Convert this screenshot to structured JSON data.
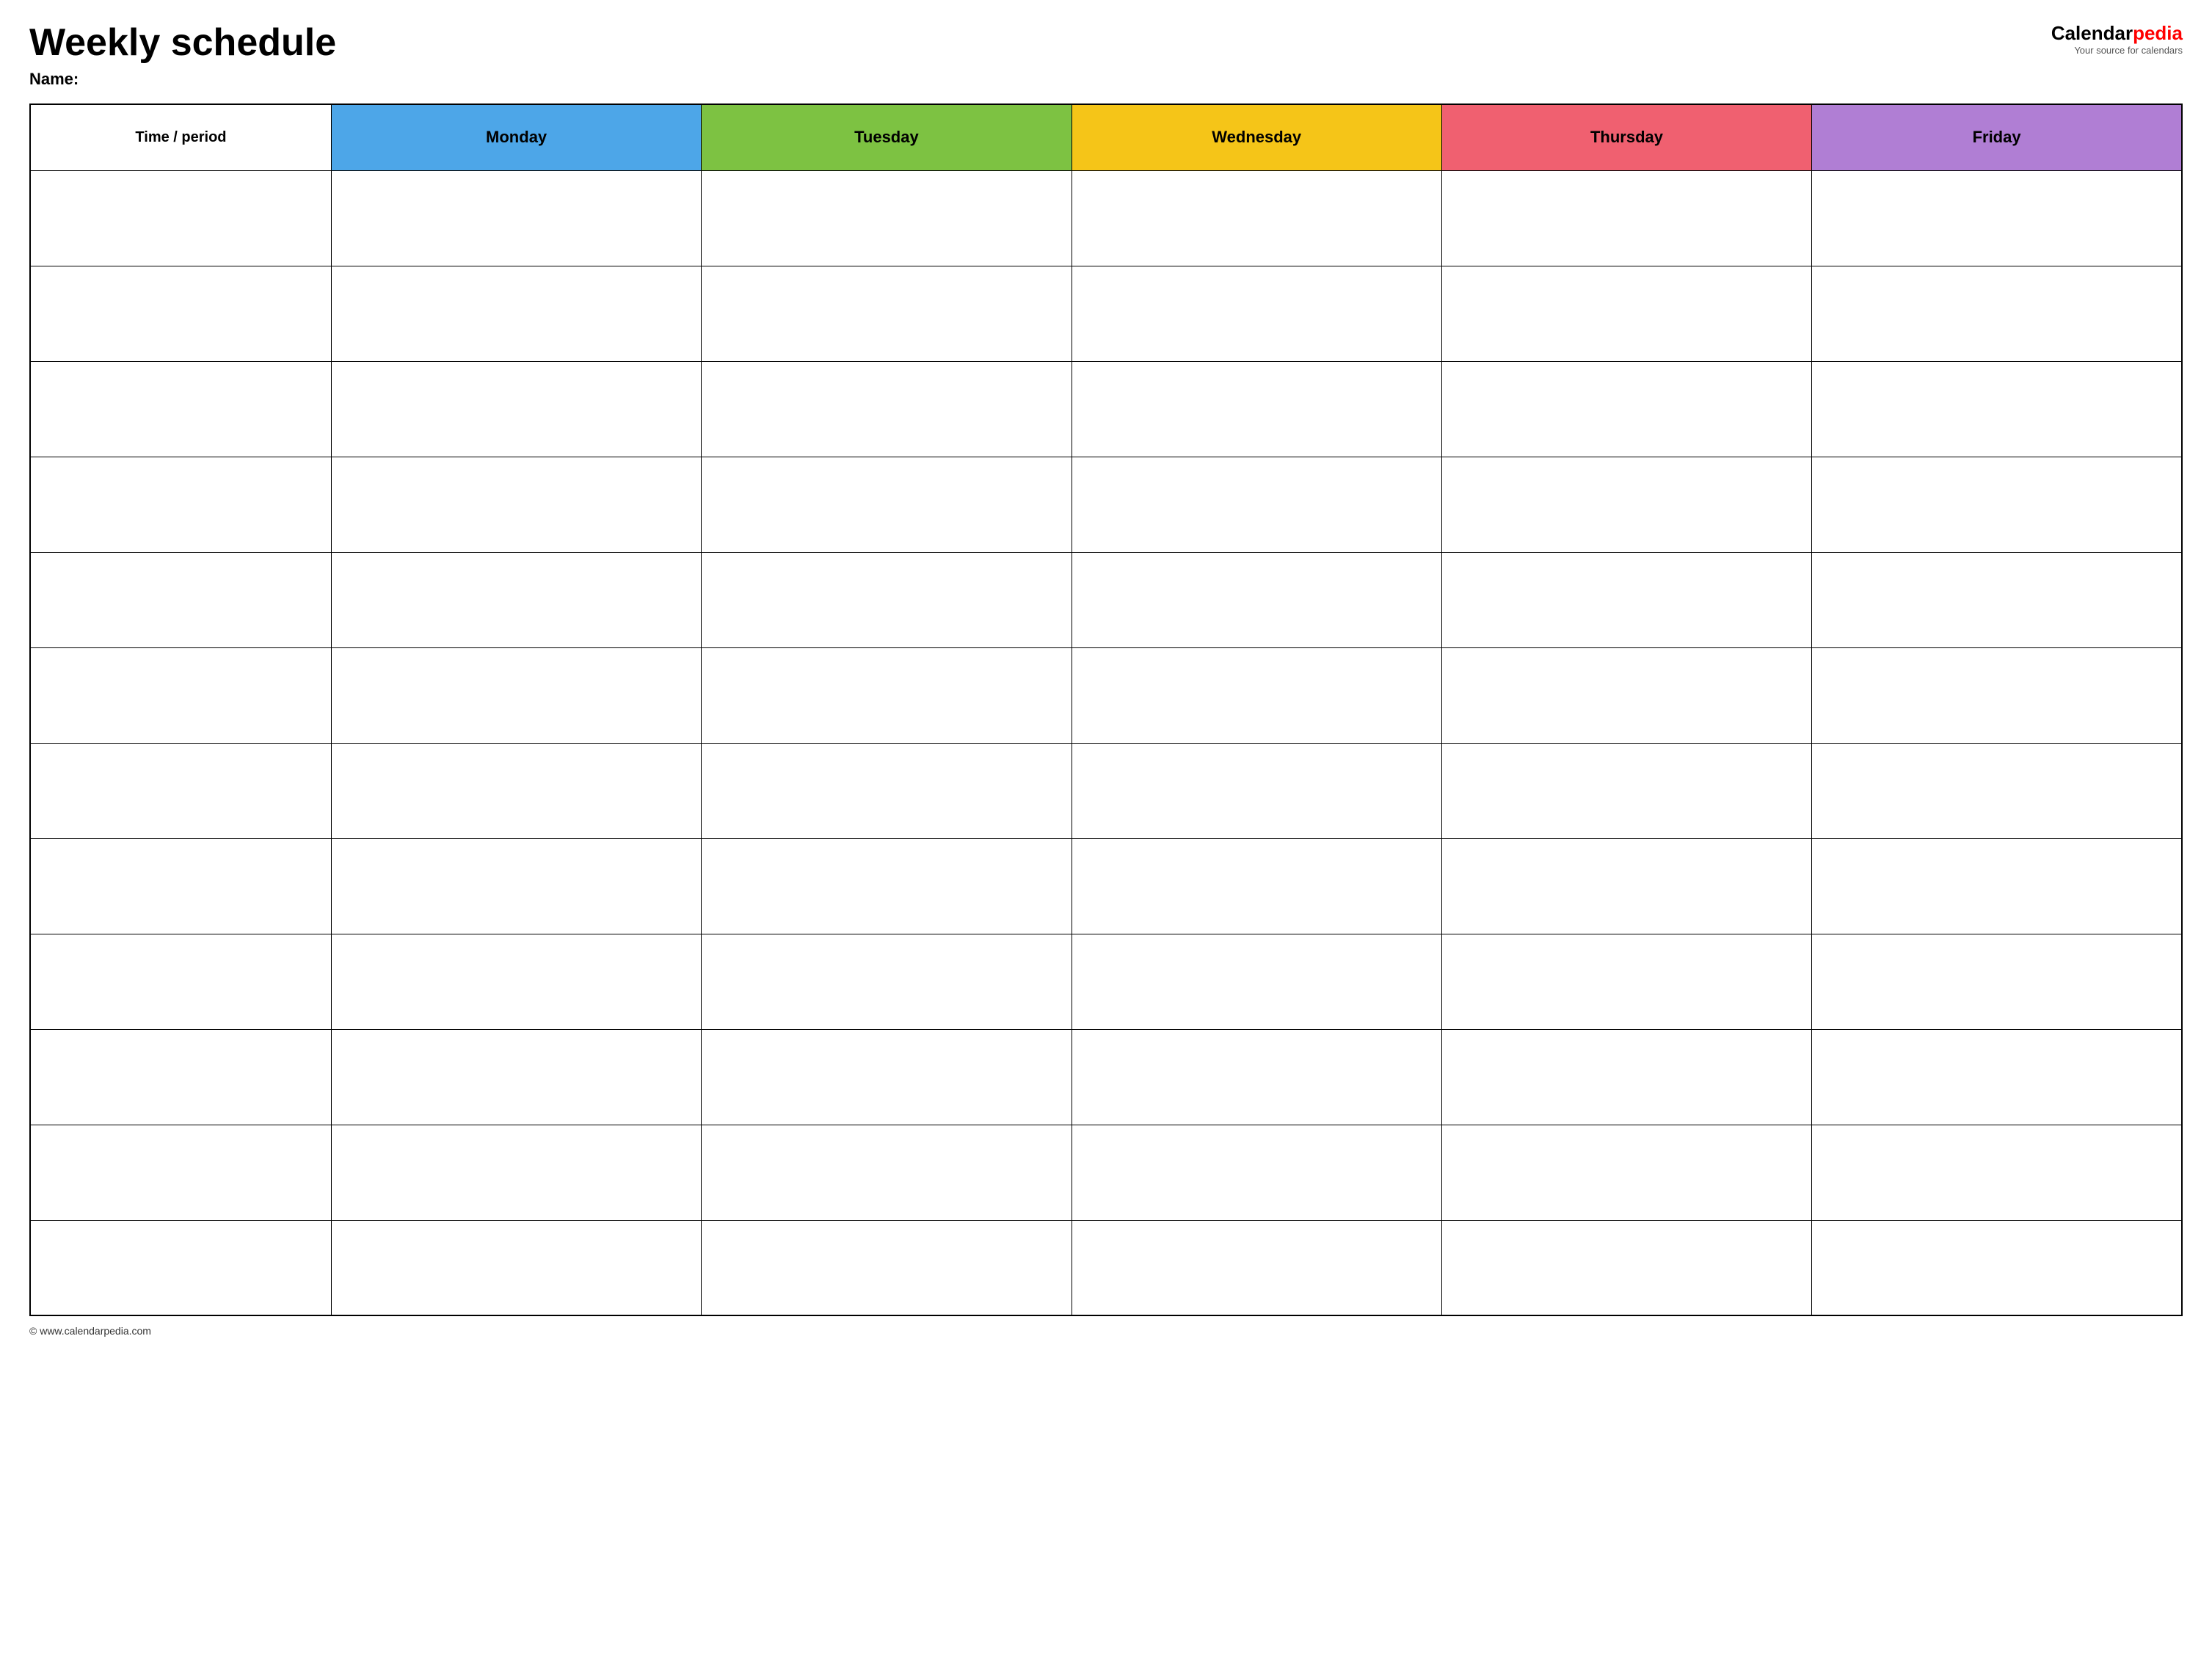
{
  "header": {
    "title": "Weekly schedule",
    "name_label": "Name:",
    "logo": {
      "calendar_text": "Calendar",
      "pedia_text": "pedia",
      "tagline": "Your source for calendars"
    }
  },
  "table": {
    "columns": [
      {
        "key": "time",
        "label": "Time / period",
        "color": "#ffffff",
        "class": "time-header"
      },
      {
        "key": "monday",
        "label": "Monday",
        "color": "#4da6e8",
        "class": "monday"
      },
      {
        "key": "tuesday",
        "label": "Tuesday",
        "color": "#7dc242",
        "class": "tuesday"
      },
      {
        "key": "wednesday",
        "label": "Wednesday",
        "color": "#f5c518",
        "class": "wednesday"
      },
      {
        "key": "thursday",
        "label": "Thursday",
        "color": "#f06070",
        "class": "thursday"
      },
      {
        "key": "friday",
        "label": "Friday",
        "color": "#b07ed4",
        "class": "friday"
      }
    ],
    "row_count": 12
  },
  "footer": {
    "url": "© www.calendarpedia.com"
  }
}
